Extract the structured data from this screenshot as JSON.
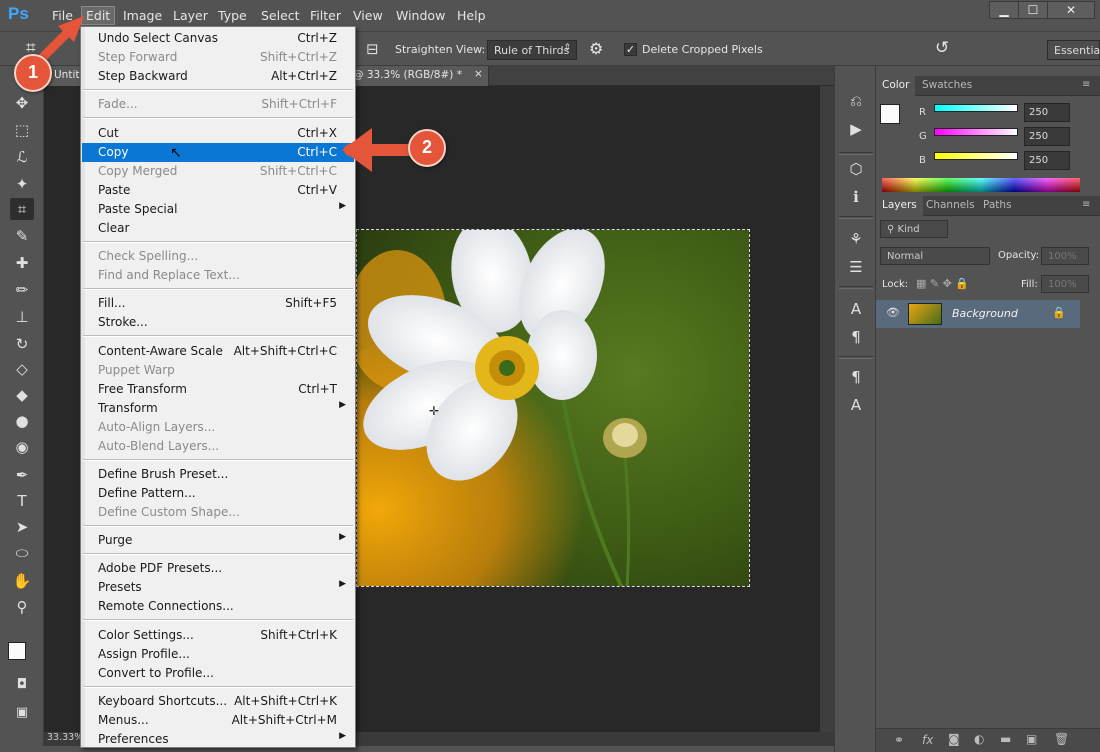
{
  "app": {
    "logo": "Ps"
  },
  "menubar": {
    "items": [
      "File",
      "Edit",
      "Image",
      "Layer",
      "Type",
      "Select",
      "Filter",
      "View",
      "Window",
      "Help"
    ]
  },
  "window_controls": {
    "minimize": "▁",
    "maximize": "☐",
    "close": "✕"
  },
  "options_bar": {
    "straighten_label": "Straighten",
    "view_label": "View:",
    "view_value": "Rule of Thirds",
    "delete_cropped_label": "Delete Cropped Pixels",
    "delete_cropped_checked": true,
    "workspace": "Essential"
  },
  "document": {
    "tab_title_left": "Untit",
    "tab_title_right": "g @ 33.3% (RGB/8#) *",
    "tab_close": "×",
    "zoom_status": "33.33%"
  },
  "edit_menu": {
    "groups": [
      [
        {
          "label": "Undo Select Canvas",
          "shortcut": "Ctrl+Z",
          "enabled": true
        },
        {
          "label": "Step Forward",
          "shortcut": "Shift+Ctrl+Z",
          "enabled": false
        },
        {
          "label": "Step Backward",
          "shortcut": "Alt+Ctrl+Z",
          "enabled": true
        }
      ],
      [
        {
          "label": "Fade...",
          "shortcut": "Shift+Ctrl+F",
          "enabled": false
        }
      ],
      [
        {
          "label": "Cut",
          "shortcut": "Ctrl+X",
          "enabled": true
        },
        {
          "label": "Copy",
          "shortcut": "Ctrl+C",
          "enabled": true,
          "highlighted": true
        },
        {
          "label": "Copy Merged",
          "shortcut": "Shift+Ctrl+C",
          "enabled": false
        },
        {
          "label": "Paste",
          "shortcut": "Ctrl+V",
          "enabled": true
        },
        {
          "label": "Paste Special",
          "shortcut": "",
          "enabled": true,
          "submenu": true
        },
        {
          "label": "Clear",
          "shortcut": "",
          "enabled": true
        }
      ],
      [
        {
          "label": "Check Spelling...",
          "shortcut": "",
          "enabled": false
        },
        {
          "label": "Find and Replace Text...",
          "shortcut": "",
          "enabled": false
        }
      ],
      [
        {
          "label": "Fill...",
          "shortcut": "Shift+F5",
          "enabled": true
        },
        {
          "label": "Stroke...",
          "shortcut": "",
          "enabled": true
        }
      ],
      [
        {
          "label": "Content-Aware Scale",
          "shortcut": "Alt+Shift+Ctrl+C",
          "enabled": true
        },
        {
          "label": "Puppet Warp",
          "shortcut": "",
          "enabled": false
        },
        {
          "label": "Free Transform",
          "shortcut": "Ctrl+T",
          "enabled": true
        },
        {
          "label": "Transform",
          "shortcut": "",
          "enabled": true,
          "submenu": true
        },
        {
          "label": "Auto-Align Layers...",
          "shortcut": "",
          "enabled": false
        },
        {
          "label": "Auto-Blend Layers...",
          "shortcut": "",
          "enabled": false
        }
      ],
      [
        {
          "label": "Define Brush Preset...",
          "shortcut": "",
          "enabled": true
        },
        {
          "label": "Define Pattern...",
          "shortcut": "",
          "enabled": true
        },
        {
          "label": "Define Custom Shape...",
          "shortcut": "",
          "enabled": false
        }
      ],
      [
        {
          "label": "Purge",
          "shortcut": "",
          "enabled": true,
          "submenu": true
        }
      ],
      [
        {
          "label": "Adobe PDF Presets...",
          "shortcut": "",
          "enabled": true
        },
        {
          "label": "Presets",
          "shortcut": "",
          "enabled": true,
          "submenu": true
        },
        {
          "label": "Remote Connections...",
          "shortcut": "",
          "enabled": true
        }
      ],
      [
        {
          "label": "Color Settings...",
          "shortcut": "Shift+Ctrl+K",
          "enabled": true
        },
        {
          "label": "Assign Profile...",
          "shortcut": "",
          "enabled": true
        },
        {
          "label": "Convert to Profile...",
          "shortcut": "",
          "enabled": true
        }
      ],
      [
        {
          "label": "Keyboard Shortcuts...",
          "shortcut": "Alt+Shift+Ctrl+K",
          "enabled": true
        },
        {
          "label": "Menus...",
          "shortcut": "Alt+Shift+Ctrl+M",
          "enabled": true
        },
        {
          "label": "Preferences",
          "shortcut": "",
          "enabled": true,
          "submenu": true
        }
      ]
    ]
  },
  "color_panel": {
    "tabs": [
      "Color",
      "Swatches"
    ],
    "channels": [
      {
        "label": "R",
        "value": "250",
        "gradient": "#00ffff,#ffffff"
      },
      {
        "label": "G",
        "value": "250",
        "gradient": "#ff00ff,#ffffff"
      },
      {
        "label": "B",
        "value": "250",
        "gradient": "#ffff00,#ffffff"
      }
    ]
  },
  "layers_panel": {
    "tabs": [
      "Layers",
      "Channels",
      "Paths"
    ],
    "filter_kind": "Kind",
    "blend_mode": "Normal",
    "opacity_label": "Opacity:",
    "opacity_value": "100%",
    "lock_label": "Lock:",
    "fill_label": "Fill:",
    "fill_value": "100%",
    "layers": [
      {
        "name": "Background",
        "visible": true,
        "locked": true
      }
    ]
  },
  "callouts": [
    {
      "number": "1"
    },
    {
      "number": "2"
    }
  ],
  "colors": {
    "accent_highlight": "#0a77d5",
    "callout": "#e4553a",
    "menu_bg": "#f0f0f0",
    "ui_bg": "#535353"
  }
}
